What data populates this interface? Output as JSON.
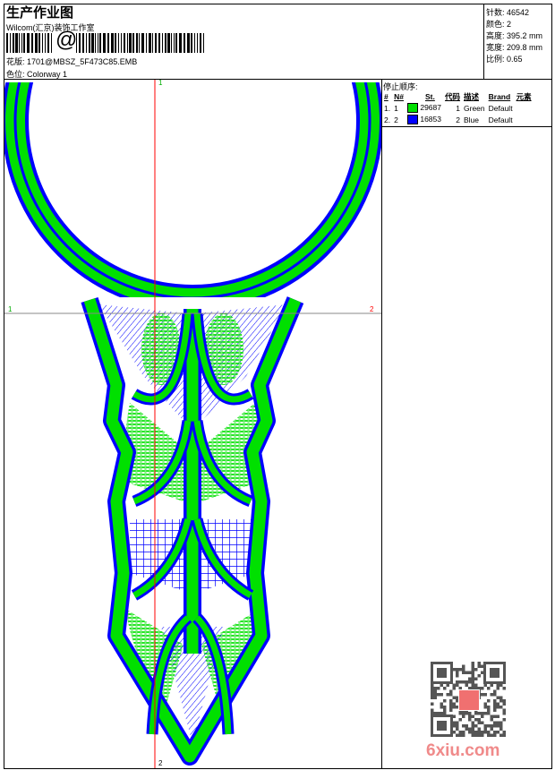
{
  "header": {
    "title": "生产作业图",
    "company": "Wilcom(汇京)装饰工作室",
    "barcode_symbol": "@",
    "design_label": "花版:",
    "design_value": "1701@MBSZ_5F473C85.EMB",
    "colorway_label": "色位:",
    "colorway_value": "Colorway 1"
  },
  "info": [
    {
      "label": "针数:",
      "value": "46542"
    },
    {
      "label": "颜色:",
      "value": "2"
    },
    {
      "label": "高度:",
      "value": "395.2 mm"
    },
    {
      "label": "宽度:",
      "value": "209.8 mm"
    },
    {
      "label": "比例:",
      "value": "0.65"
    }
  ],
  "stop_sequence": {
    "title": "停止顺序:",
    "columns": [
      "#",
      "N#",
      "St.",
      "代码",
      "描述",
      "Brand",
      "元素"
    ],
    "rows": [
      {
        "index": "1.",
        "n": "1",
        "color": "#00e000",
        "stitches": "29687",
        "code": "1",
        "desc": "Green",
        "brand": "Default"
      },
      {
        "index": "2.",
        "n": "2",
        "color": "#0000ff",
        "stitches": "16853",
        "code": "2",
        "desc": "Blue",
        "brand": "Default"
      }
    ]
  },
  "guides": {
    "v_top": "1",
    "v_bottom": "2",
    "h_left": "1",
    "h_right": "2"
  },
  "watermark": "6xiu.com",
  "colors": {
    "green": "#00e000",
    "blue": "#0000ff",
    "guide_red": "#ff0000"
  }
}
